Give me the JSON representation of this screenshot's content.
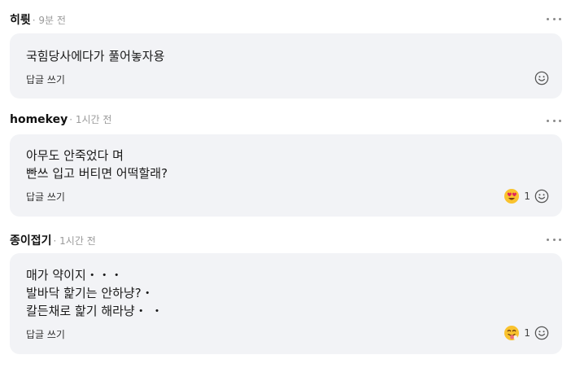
{
  "comments": [
    {
      "author": "히륏",
      "time": "· 9분 전",
      "text": "국힘당사에다가 풀어놓자용",
      "reply_label": "답글 쓰기"
    },
    {
      "author": "homekey",
      "time": "· 1시간 전",
      "text": "아무도 안죽었다 며\n빤쓰 입고 버티면 어떡할래?",
      "reply_label": "답글 쓰기",
      "reaction_icon": "heart-eyes-emoji-icon",
      "reaction_count": "1"
    },
    {
      "author": "종이접기",
      "time": "· 1시간 전",
      "text": "매가 약이지・・・\n발바닥 핥기는 안하냥?・\n칼든채로 핥기 해라냥・ ・",
      "reply_label": "답글 쓰기",
      "reaction_icon": "tongue-out-emoji-icon",
      "reaction_count": "1"
    }
  ],
  "colors": {
    "bubble_bg": "#f2f3f6",
    "meta_gray": "#9a9a9a",
    "emoji_yellow": "#f9c22e"
  }
}
